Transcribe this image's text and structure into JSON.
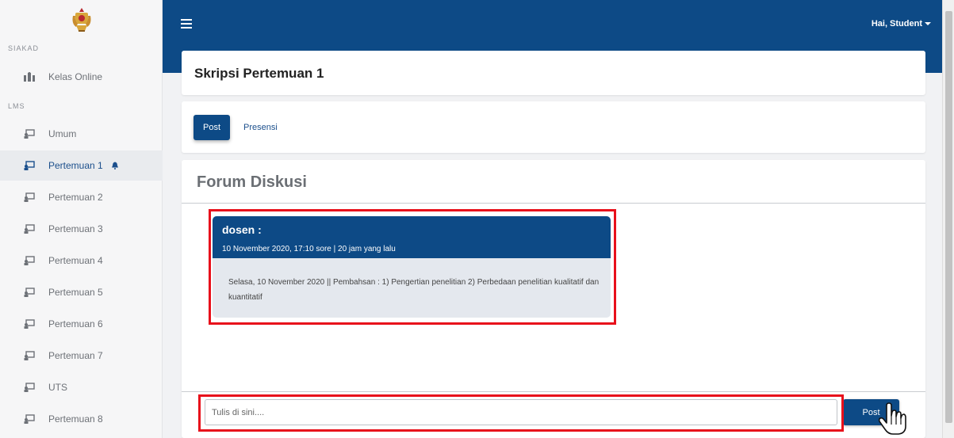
{
  "sidebar": {
    "logo": "university-crest-logo",
    "siakad_label": "SIAKAD",
    "lms_label": "LMS",
    "siakad_items": [
      {
        "label": "Kelas Online",
        "icon": "classroom-icon"
      }
    ],
    "items": [
      {
        "label": "Umum",
        "icon": "chalkboard-icon"
      },
      {
        "label": "Pertemuan 1",
        "icon": "chalkboard-icon",
        "active": true,
        "badge_icon": "bell-icon"
      },
      {
        "label": "Pertemuan 2",
        "icon": "chalkboard-icon"
      },
      {
        "label": "Pertemuan 3",
        "icon": "chalkboard-icon"
      },
      {
        "label": "Pertemuan 4",
        "icon": "chalkboard-icon"
      },
      {
        "label": "Pertemuan 5",
        "icon": "chalkboard-icon"
      },
      {
        "label": "Pertemuan 6",
        "icon": "chalkboard-icon"
      },
      {
        "label": "Pertemuan 7",
        "icon": "chalkboard-icon"
      },
      {
        "label": "UTS",
        "icon": "chalkboard-icon"
      },
      {
        "label": "Pertemuan 8",
        "icon": "chalkboard-icon"
      }
    ]
  },
  "topbar": {
    "menu_icon": "hamburger-icon",
    "user_label": "Hai, Student"
  },
  "page": {
    "title": "Skripsi Pertemuan 1",
    "tabs": [
      {
        "label": "Post",
        "active": true
      },
      {
        "label": "Presensi",
        "active": false
      }
    ]
  },
  "forum": {
    "heading": "Forum Diskusi",
    "message": {
      "author": "dosen :",
      "date": "10 November 2020, 17:10 sore | 20 jam yang lalu",
      "body": "Selasa, 10 November 2020 || Pembahsan : 1) Pengertian penelitian 2) Perbedaan penelitian kualitatif dan kuantitatif"
    },
    "input_placeholder": "Tulis di sini....",
    "post_button": "Post"
  },
  "colors": {
    "primary": "#0d4a86",
    "highlight": "#e8101b",
    "message_bg": "#e4e8ee"
  }
}
